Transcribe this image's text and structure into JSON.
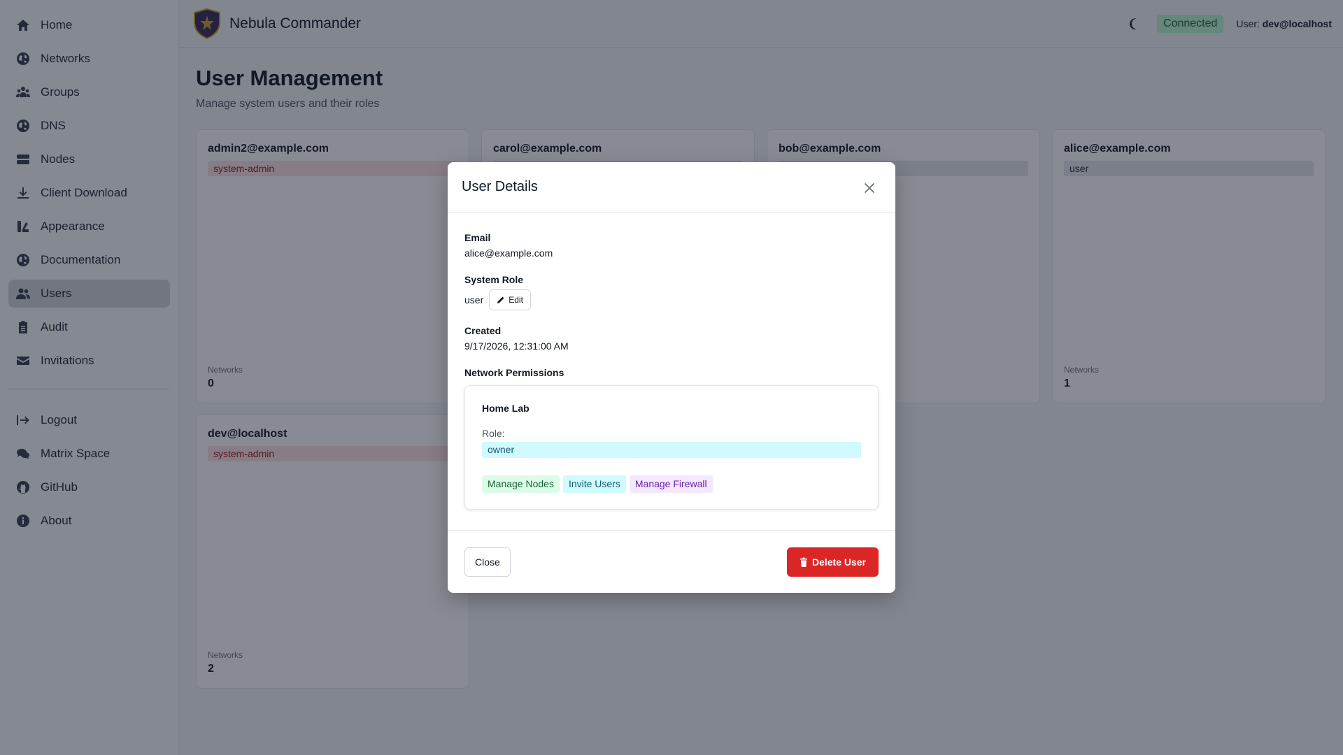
{
  "sidebar": {
    "items": [
      {
        "label": "Home",
        "icon": "home-icon"
      },
      {
        "label": "Networks",
        "icon": "globe-icon"
      },
      {
        "label": "Groups",
        "icon": "users-group-icon"
      },
      {
        "label": "DNS",
        "icon": "globe-icon"
      },
      {
        "label": "Nodes",
        "icon": "server-icon"
      },
      {
        "label": "Client Download",
        "icon": "download-icon"
      },
      {
        "label": "Appearance",
        "icon": "palette-icon"
      },
      {
        "label": "Documentation",
        "icon": "globe-icon"
      },
      {
        "label": "Users",
        "icon": "users-icon",
        "active": true
      },
      {
        "label": "Audit",
        "icon": "clipboard-icon"
      },
      {
        "label": "Invitations",
        "icon": "envelope-icon"
      }
    ],
    "bottom_items": [
      {
        "label": "Logout",
        "icon": "logout-icon"
      },
      {
        "label": "Matrix Space",
        "icon": "chat-icon"
      },
      {
        "label": "GitHub",
        "icon": "github-icon"
      },
      {
        "label": "About",
        "icon": "info-icon"
      }
    ]
  },
  "header": {
    "title": "Nebula Commander",
    "status": "Connected",
    "user_prefix": "User:",
    "user": "dev@localhost"
  },
  "main": {
    "title": "User Management",
    "subtitle": "Manage system users and their roles",
    "cards": [
      {
        "email": "admin2@example.com",
        "role": "system-admin",
        "networks_label": "Networks",
        "networks": "0"
      },
      {
        "email": "carol@example.com",
        "role": "",
        "networks_label": "",
        "networks": ""
      },
      {
        "email": "bob@example.com",
        "role": "",
        "networks_label": "",
        "networks": ""
      },
      {
        "email": "alice@example.com",
        "role": "user",
        "networks_label": "Networks",
        "networks": "1"
      },
      {
        "email": "dev@localhost",
        "role": "system-admin",
        "networks_label": "Networks",
        "networks": "2"
      }
    ]
  },
  "modal": {
    "title": "User Details",
    "email_label": "Email",
    "email": "alice@example.com",
    "role_label": "System Role",
    "role": "user",
    "edit_label": "Edit",
    "created_label": "Created",
    "created": "9/17/2026, 12:31:00 AM",
    "permissions_label": "Network Permissions",
    "permission": {
      "network": "Home Lab",
      "role_label": "Role:",
      "role": "owner",
      "tags": [
        "Manage Nodes",
        "Invite Users",
        "Manage Firewall"
      ]
    },
    "close_label": "Close",
    "delete_label": "Delete User"
  },
  "colors": {
    "accent_danger": "#dc2626",
    "connected_bg": "#bbf7d0",
    "admin_badge_bg": "#fee2e2"
  }
}
